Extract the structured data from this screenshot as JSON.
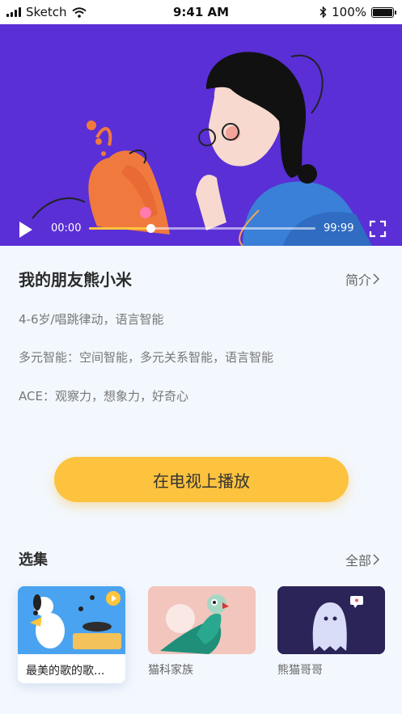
{
  "status_bar": {
    "carrier": "Sketch",
    "time": "9:41 AM",
    "battery": "100%"
  },
  "player": {
    "current_time": "00:00",
    "total_time": "99:99",
    "progress": 0.27
  },
  "detail": {
    "title": "我的朋友熊小米",
    "intro_link": "简介",
    "age_category": "4-6岁/唱跳律动，语言智能",
    "intelligence": "多元智能：空间智能，多元关系智能，语言智能",
    "ace": "ACE：观察力，想象力，好奇心"
  },
  "tv_button": "在电视上播放",
  "episodes": {
    "title": "选集",
    "all_link": "全部",
    "items": [
      {
        "label": "最美的歌的歌..."
      },
      {
        "label": "猫科家族"
      },
      {
        "label": "熊猫哥哥"
      }
    ]
  },
  "colors": {
    "video_bg": "#5a2fd6",
    "accent": "#fdc23e",
    "page_bg": "#f3f8fe"
  }
}
